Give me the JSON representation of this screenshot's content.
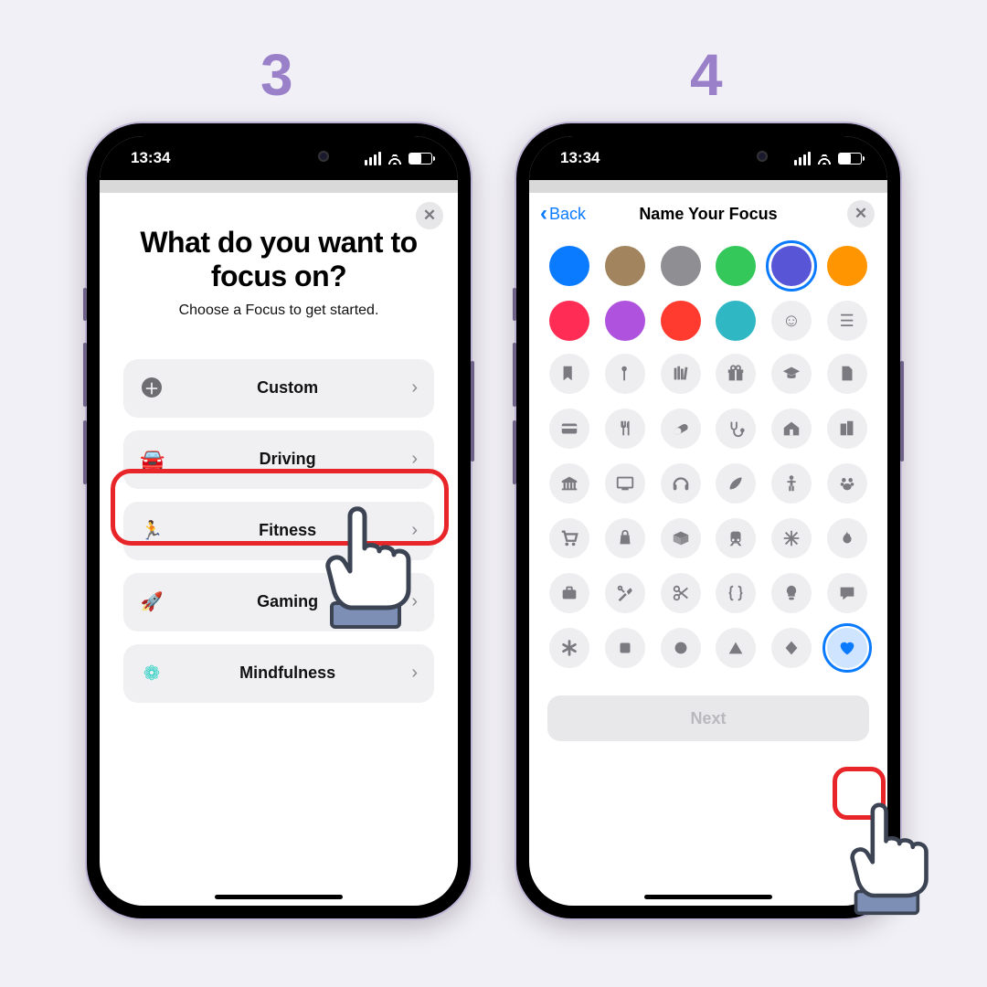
{
  "steps": [
    "3",
    "4"
  ],
  "statusbar": {
    "time": "13:34"
  },
  "screen3": {
    "title_l1": "What do you want to",
    "title_l2": "focus on?",
    "subtitle": "Choose a Focus to get started.",
    "items": [
      {
        "label": "Custom",
        "icon": "plus",
        "highlighted": true
      },
      {
        "label": "Driving",
        "icon": "car",
        "color": "#5856d6"
      },
      {
        "label": "Fitness",
        "icon": "runner",
        "color": "#34c759"
      },
      {
        "label": "Gaming",
        "icon": "rocket",
        "color": "#0a7aff"
      },
      {
        "label": "Mindfulness",
        "icon": "flower",
        "color": "#30d0c4"
      }
    ]
  },
  "screen4": {
    "back": "Back",
    "title": "Name Your Focus",
    "next": "Next",
    "colors": [
      "#0a7aff",
      "#a2845e",
      "#8e8e93",
      "#34c759",
      "#5856d6",
      "#ff9500",
      "#ff2d55",
      "#af52de",
      "#ff3b30",
      "#2fb7c3",
      "emoji",
      "more"
    ],
    "selectedColorIndex": 4,
    "icons": [
      "bookmark",
      "pin",
      "books",
      "gift",
      "grad",
      "file",
      "card",
      "fork",
      "pill",
      "steth",
      "house",
      "buildings",
      "museum",
      "tv",
      "headphones",
      "leaf",
      "person",
      "paws",
      "cart",
      "bag",
      "box",
      "train",
      "snow",
      "fire",
      "briefcase",
      "tools",
      "scissors",
      "braces",
      "bulb",
      "chat",
      "asterisk",
      "square",
      "circle-filled",
      "triangle",
      "diamond",
      "heart"
    ],
    "selectedIcon": "heart"
  }
}
